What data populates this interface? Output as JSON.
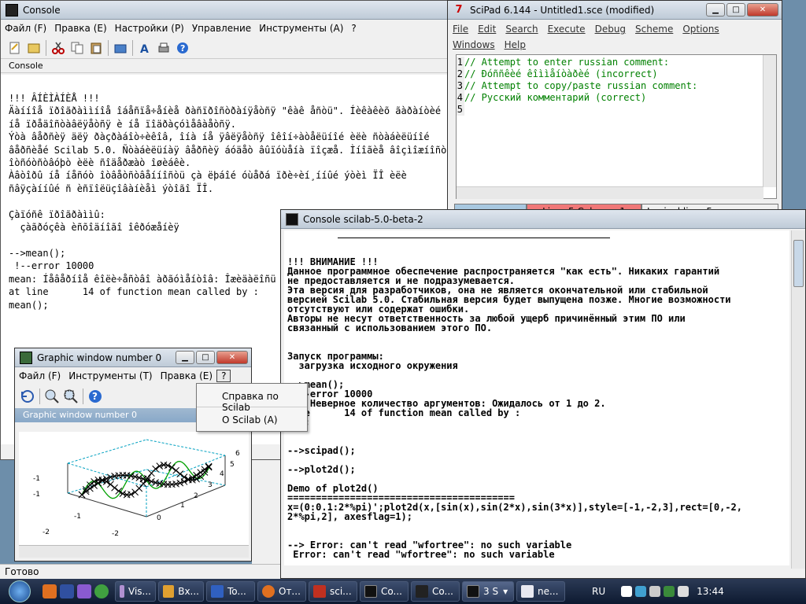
{
  "console": {
    "title": "Console",
    "menu": [
      "Файл (F)",
      "Правка (E)",
      "Настройки (P)",
      "Управление",
      "Инструменты (A)",
      "?"
    ],
    "tab_label": "Console",
    "lines": [
      "!!! ÂÍÈÌÀÍÈÅ !!!",
      "Äàííîå ïðîãðàììíîå îáåñïå÷åíèå ðàñïðîñòðàíÿåòñÿ \"êàê åñòü\". Íèêàêèõ ãàðàíòèé",
      "íå ïðåäîñòàâëÿåòñÿ è íå ïîäðàçóìåâàåòñÿ.",
      "Ýòà âåðñèÿ äëÿ ðàçðàáîò÷èêîâ, îíà íå ÿâëÿåòñÿ îêîí÷àòåëüíîé èëè ñòàáèëüíîé",
      "âåðñèåé Scilab 5.0. Ñòàáèëüíàÿ âåðñèÿ áóäåò âûïóùåíà ïîçæå. Ìíîãèå âîçìîæíîñòè",
      "îòñóòñòâóþò èëè ñîäåðæàò îøèáêè.",
      "Àâòîðû íå íåñóò îòâåòñòâåííîñòü çà ëþáîé óùåðá ïðè÷èí¸ííûé ýòèì ÏÎ èëè",
      "ñâÿçàííûé ñ èñïîëüçîâàíèåì ýòîãî ÏÎ.",
      "",
      "Çàïóñê ïðîãðàììû:",
      "  çàãðóçêà èñõîäíîãî îêðóæåíèÿ",
      "",
      "-->mean();",
      " !--error 10000",
      "mean: Íåâåðíîå êîëè÷åñòâî àðãóìåíòîâ: Îæèäàëîñü îò 1 äî 2.",
      "at line      14 of function mean called by :",
      "mean();"
    ],
    "status": "Готово"
  },
  "scipad": {
    "title": "SciPad 6.144 - Untitled1.sce (modified)",
    "menu": [
      "File",
      "Edit",
      "Search",
      "Execute",
      "Debug",
      "Scheme",
      "Options",
      "Windows",
      "Help"
    ],
    "lines": [
      {
        "n": "1",
        "text": "// Attempt to enter russian comment:"
      },
      {
        "n": "2",
        "text": "// Ðóññêèé êîììåíòàðèé (incorrect)"
      },
      {
        "n": "3",
        "text": "// Attempt to copy/paste russian comment:"
      },
      {
        "n": "4",
        "text": "// Русский комментарий (correct)"
      },
      {
        "n": "5",
        "text": ""
      }
    ],
    "status_pos": "Line: 5 Column: 1",
    "status_logical": "Logical line: 5"
  },
  "console2": {
    "title": "Console scilab-5.0-beta-2",
    "lines": [
      "",
      "",
      "!!! ВНИМАНИЕ !!!",
      "Данное программное обеспечение распространяется \"как есть\". Никаких гарантий",
      "не предоставляется и не подразумевается.",
      "Эта версия для разработчиков, она не является окончательной или стабильной",
      "версией Scilab 5.0. Стабильная версия будет выпущена позже. Многие возможности",
      "отсутствуют или содержат ошибки.",
      "Авторы не несут ответственность за любой ущерб причинённый этим ПО или",
      "связанный с использованием этого ПО.",
      "",
      "",
      "Запуск программы:",
      "  загрузка исходного окружения",
      "",
      "-->mean();",
      " !--error 10000",
      "an: Неверное количество аргументов: Ожидалось от 1 до 2.",
      "line      14 of function mean called by :",
      "n();",
      "",
      "",
      "-->scipad();",
      "",
      "-->plot2d();",
      "",
      "Demo of plot2d()",
      "========================================",
      "x=(0:0.1:2*%pi)';plot2d(x,[sin(x),sin(2*x),sin(3*x)],style=[-1,-2,3],rect=[0,-2,",
      "2*%pi,2], axesflag=1);",
      "",
      "",
      "--> Error: can't read \"wfortree\": no such variable",
      " Error: can't read \"wfortree\": no such variable"
    ]
  },
  "graphic": {
    "title": "Graphic window number 0",
    "menu": [
      "Файл (F)",
      "Инструменты (T)",
      "Правка (E)",
      "?"
    ],
    "canvas_title": "Graphic window number 0",
    "popup": [
      "Справка по Scilab",
      "О Scilab (A)"
    ],
    "ticks": [
      "-1",
      "-1",
      "-2",
      "-2",
      "-1",
      "0",
      "1",
      "2",
      "3",
      "4",
      "5",
      "6"
    ]
  },
  "taskbar": {
    "buttons": [
      "Vis...",
      "Вх...",
      "To...",
      "От...",
      "sci...",
      "Co...",
      "Co...",
      "3 S",
      "ne..."
    ],
    "lang": "RU",
    "clock": "13:44"
  },
  "colors": {
    "accent": "#c63a2a",
    "scipad_status_red": "#f07878",
    "scipad_status_blue": "#a8c8e0",
    "comment_green": "#008000"
  }
}
